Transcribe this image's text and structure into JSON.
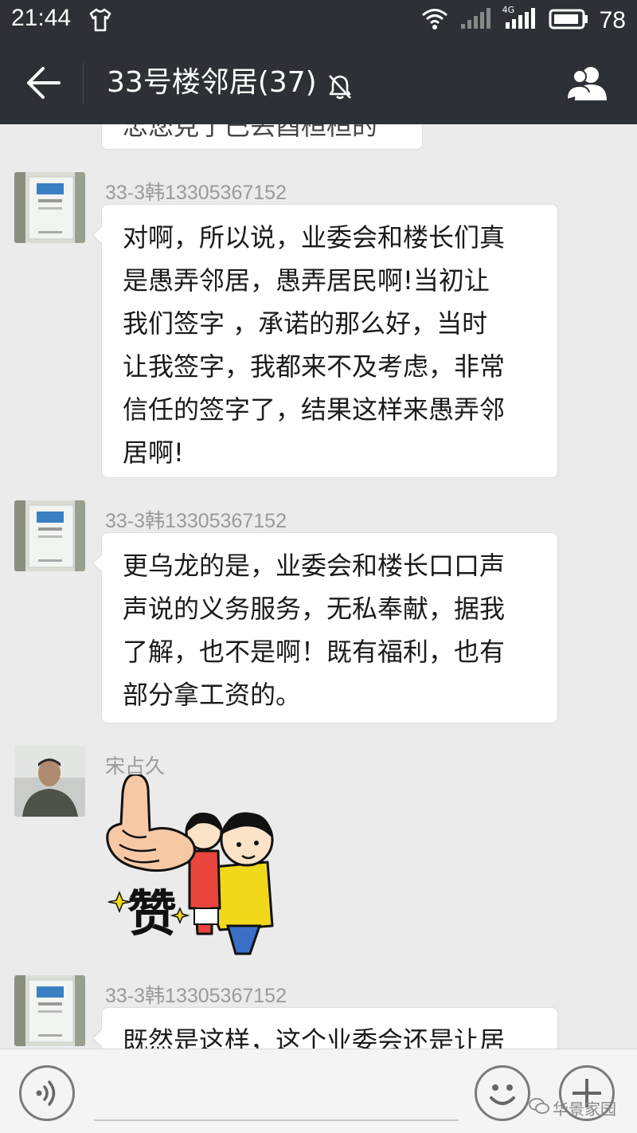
{
  "status_bar": {
    "time": "21:44",
    "battery": "78",
    "network": "4G"
  },
  "header": {
    "title": "33号楼邻居(37)"
  },
  "messages": [
    {
      "lines": [
        "忠您見亍巴丟酉桓桓的"
      ]
    },
    {
      "sender": "33-3韩13305367152",
      "lines": [
        "对啊，所以说，业委会和楼长们真",
        "是愚弄邻居，愚弄居民啊!当初让",
        "我们签字 ，承诺的那么好，当时",
        "让我签字，我都来不及考虑，非常",
        "信任的签字了，结果这样来愚弄邻",
        "居啊!"
      ]
    },
    {
      "sender": "33-3韩13305367152",
      "lines": [
        "更乌龙的是，业委会和楼长口口声",
        "声说的义务服务，无私奉献，据我",
        "了解，也不是啊！既有福利，也有",
        "部分拿工资的。"
      ]
    },
    {
      "sender": "宋占久",
      "sticker_text": "赞"
    },
    {
      "sender": "33-3韩13305367152",
      "lines": [
        "既然是这样，这个业委会还是让居"
      ]
    }
  ],
  "watermark": "华景家园",
  "icons": {
    "back": "back-arrow-icon",
    "mute": "mute-bell-icon",
    "members": "group-members-icon",
    "voice": "voice-input-icon",
    "emoji": "emoji-icon",
    "plus": "more-plus-icon"
  },
  "colors": {
    "header_bg": "#2d3036",
    "chat_bg": "#ebebeb",
    "bubble_bg": "#ffffff"
  }
}
